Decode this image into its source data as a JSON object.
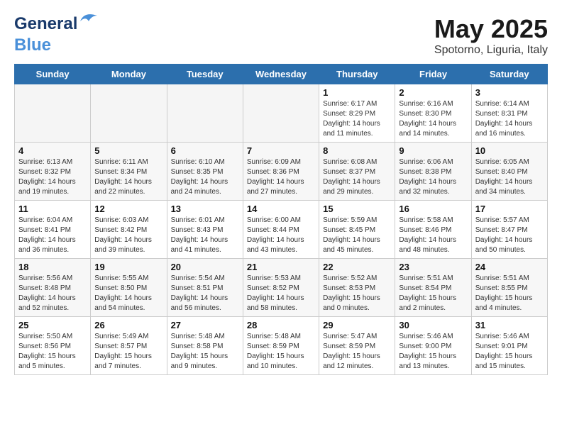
{
  "logo": {
    "part1": "General",
    "part2": "Blue"
  },
  "title": "May 2025",
  "subtitle": "Spotorno, Liguria, Italy",
  "days_of_week": [
    "Sunday",
    "Monday",
    "Tuesday",
    "Wednesday",
    "Thursday",
    "Friday",
    "Saturday"
  ],
  "weeks": [
    [
      {
        "num": "",
        "info": ""
      },
      {
        "num": "",
        "info": ""
      },
      {
        "num": "",
        "info": ""
      },
      {
        "num": "",
        "info": ""
      },
      {
        "num": "1",
        "info": "Sunrise: 6:17 AM\nSunset: 8:29 PM\nDaylight: 14 hours\nand 11 minutes."
      },
      {
        "num": "2",
        "info": "Sunrise: 6:16 AM\nSunset: 8:30 PM\nDaylight: 14 hours\nand 14 minutes."
      },
      {
        "num": "3",
        "info": "Sunrise: 6:14 AM\nSunset: 8:31 PM\nDaylight: 14 hours\nand 16 minutes."
      }
    ],
    [
      {
        "num": "4",
        "info": "Sunrise: 6:13 AM\nSunset: 8:32 PM\nDaylight: 14 hours\nand 19 minutes."
      },
      {
        "num": "5",
        "info": "Sunrise: 6:11 AM\nSunset: 8:34 PM\nDaylight: 14 hours\nand 22 minutes."
      },
      {
        "num": "6",
        "info": "Sunrise: 6:10 AM\nSunset: 8:35 PM\nDaylight: 14 hours\nand 24 minutes."
      },
      {
        "num": "7",
        "info": "Sunrise: 6:09 AM\nSunset: 8:36 PM\nDaylight: 14 hours\nand 27 minutes."
      },
      {
        "num": "8",
        "info": "Sunrise: 6:08 AM\nSunset: 8:37 PM\nDaylight: 14 hours\nand 29 minutes."
      },
      {
        "num": "9",
        "info": "Sunrise: 6:06 AM\nSunset: 8:38 PM\nDaylight: 14 hours\nand 32 minutes."
      },
      {
        "num": "10",
        "info": "Sunrise: 6:05 AM\nSunset: 8:40 PM\nDaylight: 14 hours\nand 34 minutes."
      }
    ],
    [
      {
        "num": "11",
        "info": "Sunrise: 6:04 AM\nSunset: 8:41 PM\nDaylight: 14 hours\nand 36 minutes."
      },
      {
        "num": "12",
        "info": "Sunrise: 6:03 AM\nSunset: 8:42 PM\nDaylight: 14 hours\nand 39 minutes."
      },
      {
        "num": "13",
        "info": "Sunrise: 6:01 AM\nSunset: 8:43 PM\nDaylight: 14 hours\nand 41 minutes."
      },
      {
        "num": "14",
        "info": "Sunrise: 6:00 AM\nSunset: 8:44 PM\nDaylight: 14 hours\nand 43 minutes."
      },
      {
        "num": "15",
        "info": "Sunrise: 5:59 AM\nSunset: 8:45 PM\nDaylight: 14 hours\nand 45 minutes."
      },
      {
        "num": "16",
        "info": "Sunrise: 5:58 AM\nSunset: 8:46 PM\nDaylight: 14 hours\nand 48 minutes."
      },
      {
        "num": "17",
        "info": "Sunrise: 5:57 AM\nSunset: 8:47 PM\nDaylight: 14 hours\nand 50 minutes."
      }
    ],
    [
      {
        "num": "18",
        "info": "Sunrise: 5:56 AM\nSunset: 8:48 PM\nDaylight: 14 hours\nand 52 minutes."
      },
      {
        "num": "19",
        "info": "Sunrise: 5:55 AM\nSunset: 8:50 PM\nDaylight: 14 hours\nand 54 minutes."
      },
      {
        "num": "20",
        "info": "Sunrise: 5:54 AM\nSunset: 8:51 PM\nDaylight: 14 hours\nand 56 minutes."
      },
      {
        "num": "21",
        "info": "Sunrise: 5:53 AM\nSunset: 8:52 PM\nDaylight: 14 hours\nand 58 minutes."
      },
      {
        "num": "22",
        "info": "Sunrise: 5:52 AM\nSunset: 8:53 PM\nDaylight: 15 hours\nand 0 minutes."
      },
      {
        "num": "23",
        "info": "Sunrise: 5:51 AM\nSunset: 8:54 PM\nDaylight: 15 hours\nand 2 minutes."
      },
      {
        "num": "24",
        "info": "Sunrise: 5:51 AM\nSunset: 8:55 PM\nDaylight: 15 hours\nand 4 minutes."
      }
    ],
    [
      {
        "num": "25",
        "info": "Sunrise: 5:50 AM\nSunset: 8:56 PM\nDaylight: 15 hours\nand 5 minutes."
      },
      {
        "num": "26",
        "info": "Sunrise: 5:49 AM\nSunset: 8:57 PM\nDaylight: 15 hours\nand 7 minutes."
      },
      {
        "num": "27",
        "info": "Sunrise: 5:48 AM\nSunset: 8:58 PM\nDaylight: 15 hours\nand 9 minutes."
      },
      {
        "num": "28",
        "info": "Sunrise: 5:48 AM\nSunset: 8:59 PM\nDaylight: 15 hours\nand 10 minutes."
      },
      {
        "num": "29",
        "info": "Sunrise: 5:47 AM\nSunset: 8:59 PM\nDaylight: 15 hours\nand 12 minutes."
      },
      {
        "num": "30",
        "info": "Sunrise: 5:46 AM\nSunset: 9:00 PM\nDaylight: 15 hours\nand 13 minutes."
      },
      {
        "num": "31",
        "info": "Sunrise: 5:46 AM\nSunset: 9:01 PM\nDaylight: 15 hours\nand 15 minutes."
      }
    ]
  ]
}
